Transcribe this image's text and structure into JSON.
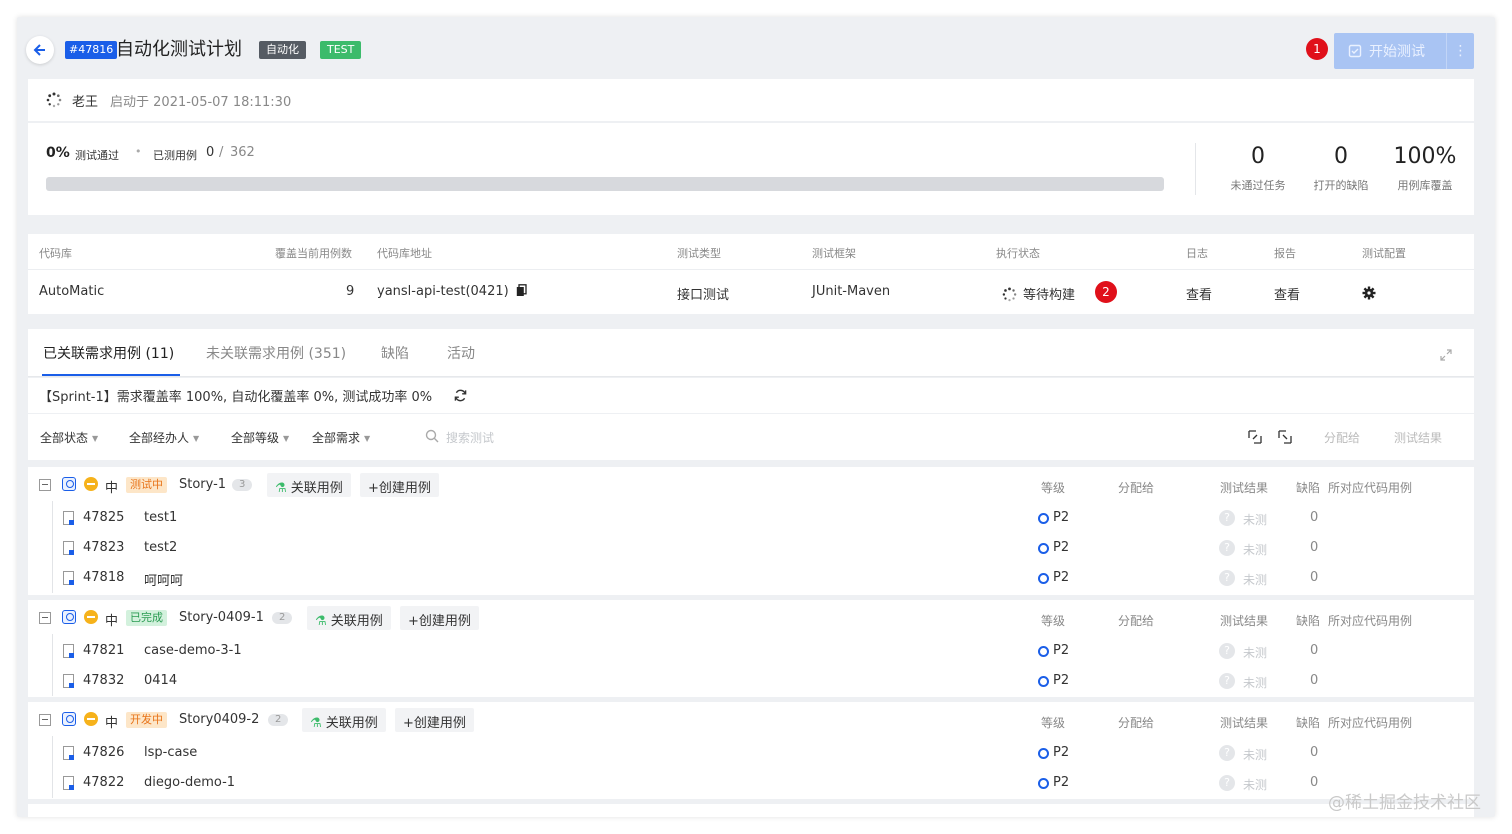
{
  "header": {
    "plan_id": "#47816",
    "title": "自动化测试计划",
    "tag_auto": "自动化",
    "tag_test": "TEST",
    "marker_1": "1",
    "start_button": "开始测试"
  },
  "info": {
    "user": "老王",
    "started": "启动于 2021-05-07 18:11:30"
  },
  "summary": {
    "pass_pct": "0%",
    "pass_label": "测试通过",
    "tested_label": "已测用例",
    "tested_count": "0",
    "separator": "/",
    "total": "362",
    "progress_fraction": 0,
    "stats": [
      {
        "value": "0",
        "label": "未通过任务"
      },
      {
        "value": "0",
        "label": "打开的缺陷"
      },
      {
        "value": "100%",
        "label": "用例库覆盖"
      }
    ]
  },
  "repo_table": {
    "headers": [
      "代码库",
      "覆盖当前用例数",
      "代码库地址",
      "测试类型",
      "测试框架",
      "执行状态",
      "日志",
      "报告",
      "测试配置"
    ],
    "row": {
      "repo": "AutoMatic",
      "count": "9",
      "address": "yansl-api-test(0421)",
      "type": "接口测试",
      "framework": "JUnit-Maven",
      "status": "等待构建",
      "marker_2": "2",
      "log": "查看",
      "report": "查看"
    }
  },
  "tabs": [
    {
      "label": "已关联需求用例 (11)"
    },
    {
      "label": "未关联需求用例 (351)"
    },
    {
      "label": "缺陷"
    },
    {
      "label": "活动"
    }
  ],
  "sprint_summary": "【Sprint-1】需求覆盖率 100%, 自动化覆盖率 0%, 测试成功率 0%",
  "filters": {
    "status": "全部状态",
    "assignee": "全部经办人",
    "level": "全部等级",
    "requirement": "全部需求",
    "search_placeholder": "搜索测试",
    "assign": "分配给",
    "result": "测试结果"
  },
  "columns": {
    "level": "等级",
    "assign": "分配给",
    "result": "测试结果",
    "defect": "缺陷",
    "code_case": "所对应代码用例"
  },
  "groups": [
    {
      "priority": "中",
      "status": "测试中",
      "story": "Story-1",
      "count": "3",
      "link_btn": "关联用例",
      "create_btn": "+创建用例",
      "cases": [
        {
          "id": "47825",
          "name": "test1",
          "level": "P2",
          "result": "未测",
          "defects": "0"
        },
        {
          "id": "47823",
          "name": "test2",
          "level": "P2",
          "result": "未测",
          "defects": "0"
        },
        {
          "id": "47818",
          "name": "呵呵呵",
          "level": "P2",
          "result": "未测",
          "defects": "0"
        }
      ]
    },
    {
      "priority": "中",
      "status": "已完成",
      "story": "Story-0409-1",
      "count": "2",
      "link_btn": "关联用例",
      "create_btn": "+创建用例",
      "cases": [
        {
          "id": "47821",
          "name": "case-demo-3-1",
          "level": "P2",
          "result": "未测",
          "defects": "0"
        },
        {
          "id": "47832",
          "name": "0414",
          "level": "P2",
          "result": "未测",
          "defects": "0"
        }
      ]
    },
    {
      "priority": "中",
      "status": "开发中",
      "story": "Story0409-2",
      "count": "2",
      "link_btn": "关联用例",
      "create_btn": "+创建用例",
      "cases": [
        {
          "id": "47826",
          "name": "lsp-case",
          "level": "P2",
          "result": "未测",
          "defects": "0"
        },
        {
          "id": "47822",
          "name": "diego-demo-1",
          "level": "P2",
          "result": "未测",
          "defects": "0"
        }
      ]
    }
  ],
  "watermark": "@稀土掘金技术社区",
  "colors": {
    "accent": "#1a5ee8",
    "success": "#3cbb6b",
    "danger": "#e0101a",
    "warning": "#f6b21b"
  }
}
